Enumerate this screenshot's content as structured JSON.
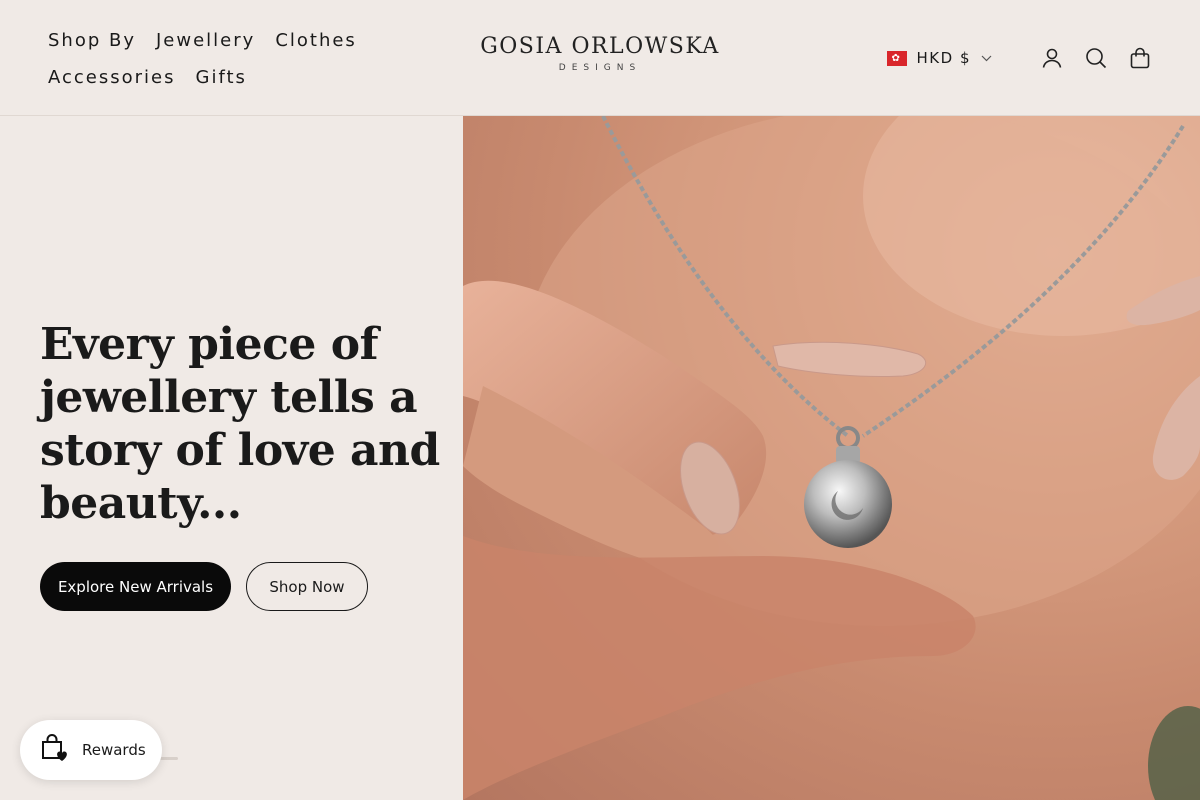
{
  "nav": {
    "row1": [
      "Shop By",
      "Jewellery",
      "Clothes"
    ],
    "row2": [
      "Accessories",
      "Gifts"
    ]
  },
  "logo": {
    "main": "GOSIA ORLOWSKA",
    "sub": "DESIGNS"
  },
  "header_right": {
    "currency": "HKD $",
    "icons": [
      "account-icon",
      "search-icon",
      "cart-icon"
    ]
  },
  "hero": {
    "title": "Every piece of jewellery tells a story of love and beauty...",
    "primary_button": "Explore New Arrivals",
    "secondary_button": "Shop Now"
  },
  "rewards": {
    "label": "Rewards"
  },
  "colors": {
    "background": "#f0eae6",
    "button_dark": "#0a0a0a",
    "flag_red": "#d9262b"
  }
}
